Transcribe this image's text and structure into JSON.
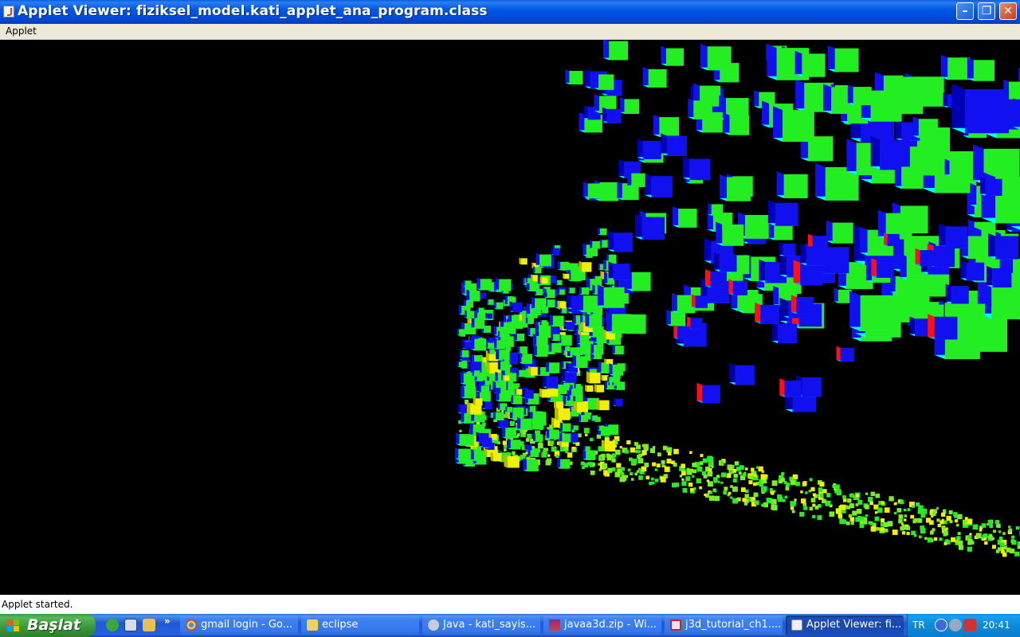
{
  "window": {
    "title": "Applet Viewer: fiziksel_model.kati_applet_ana_program.class",
    "controls": {
      "minimize": "–",
      "maximize": "❐",
      "close": "✕"
    }
  },
  "menu": {
    "items": [
      "Applet"
    ]
  },
  "status": {
    "text": "Applet started."
  },
  "taskbar": {
    "start_label": "Başlat",
    "quicklaunch_more": "»",
    "tasks": [
      {
        "label": "gmail login - Go...",
        "icon": "chrome-icon",
        "active": false
      },
      {
        "label": "eclipse",
        "icon": "folder-icon",
        "active": false
      },
      {
        "label": "Java - kati_sayis...",
        "icon": "eclipse-icon",
        "active": false
      },
      {
        "label": "javaa3d.zip - Wi...",
        "icon": "winrar-icon",
        "active": false
      },
      {
        "label": "j3d_tutorial_ch1....",
        "icon": "pdf-icon",
        "active": false
      },
      {
        "label": "Applet Viewer: fi...",
        "icon": "java-icon",
        "active": true
      }
    ],
    "tray": {
      "language": "TR",
      "clock": "20:41"
    }
  },
  "scene": {
    "description_colors": {
      "green": "#22ee22",
      "blue": "#1010f0",
      "cyan": "#00ffff",
      "red": "#ff1010",
      "yellow": "#f0f000"
    }
  }
}
